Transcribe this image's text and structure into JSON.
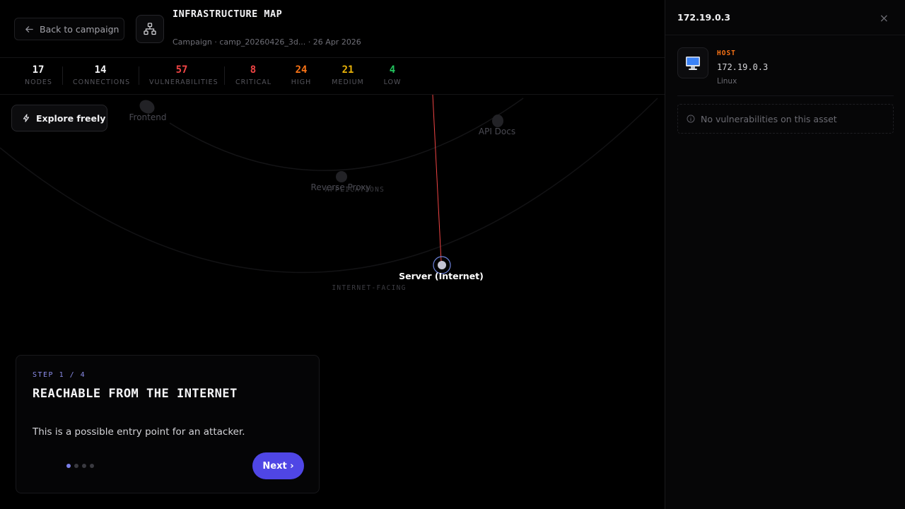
{
  "header": {
    "back_label": "Back to campaign",
    "title": "INFRASTRUCTURE MAP",
    "subtitle": "Campaign · camp_20260426_3d... · 26 Apr 2026"
  },
  "stats": [
    {
      "value": "17",
      "label": "NODES",
      "color": "#f2f2f4"
    },
    {
      "value": "14",
      "label": "CONNECTIONS",
      "color": "#f2f2f4"
    },
    {
      "value": "57",
      "label": "VULNERABILITIES",
      "color": "#ef4444"
    },
    {
      "value": "8",
      "label": "CRITICAL",
      "color": "#ef4444"
    },
    {
      "value": "24",
      "label": "HIGH",
      "color": "#f97316"
    },
    {
      "value": "21",
      "label": "MEDIUM",
      "color": "#eab308"
    },
    {
      "value": "4",
      "label": "LOW",
      "color": "#22c55e"
    }
  ],
  "canvas": {
    "explore_label": "Explore freely",
    "nodes": {
      "frontend": "Frontend",
      "api_docs": "API Docs",
      "reverse_proxy": "Reverse Proxy",
      "selected": "Server (Internet)"
    },
    "groups": {
      "applications": "APPLICATIONS",
      "internet_facing": "INTERNET-FACING"
    },
    "edge_color": "#ef4444"
  },
  "tour": {
    "step": "STEP 1 / 4",
    "title": "REACHABLE FROM THE INTERNET",
    "body": "This is a possible entry point for an attacker.",
    "total_steps": 4,
    "current_step": 1,
    "next_label": "Next ›"
  },
  "panel": {
    "title": "172.19.0.3",
    "close_icon": "×",
    "asset_type": "HOST",
    "asset_ip": "172.19.0.3",
    "asset_os": "Linux",
    "no_vuln_text": "No vulnerabilities on this asset",
    "accent": "#f97316"
  }
}
